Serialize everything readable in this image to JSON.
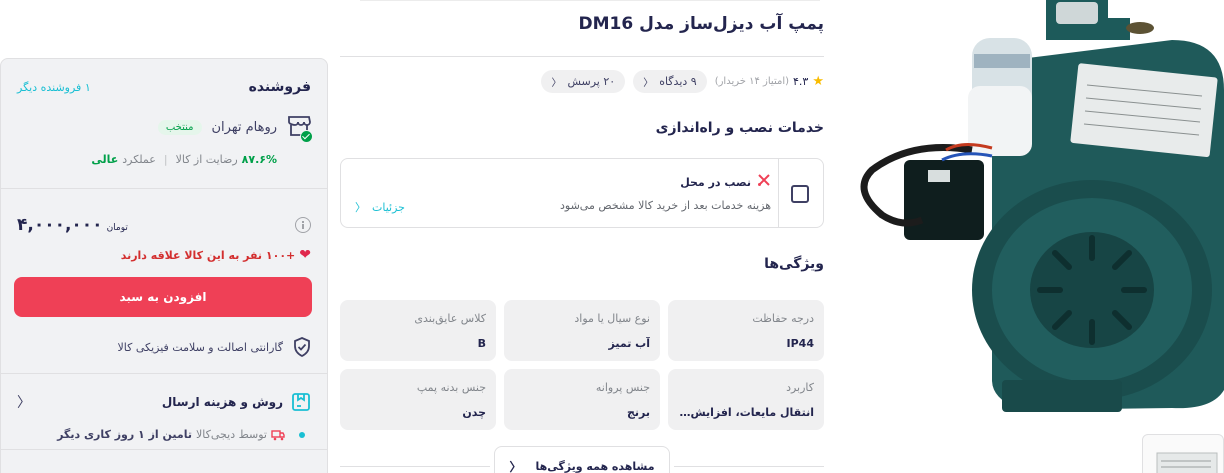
{
  "product": {
    "title": "پمپ آب دیزل‌ساز مدل DM16",
    "rating": "۴.۳",
    "rating_count": "(امتیاز ۱۴ خریدار)",
    "reviews_pill": "۹ دیدگاه",
    "questions_pill": "۲۰ پرسش"
  },
  "services": {
    "title": "خدمات نصب و راه‌اندازی",
    "item_name": "نصب در محل",
    "item_desc": "هزینه خدمات بعد از خرید کالا مشخص می‌شود",
    "details_label": "جزئیات"
  },
  "features": {
    "title": "ویژگی‌ها",
    "items": [
      {
        "label": "درجه حفاظت",
        "value": "IP44"
      },
      {
        "label": "نوع سیال یا مواد",
        "value": "آب تمیز"
      },
      {
        "label": "کلاس عایق‌بندی",
        "value": "B"
      },
      {
        "label": "کاربرد",
        "value": "انتقال مایعات، افزایش ف..."
      },
      {
        "label": "جنس پروانه",
        "value": "برنج"
      },
      {
        "label": "جنس بدنه پمپ",
        "value": "چدن"
      }
    ],
    "all_label": "مشاهده همه ویژگی‌ها"
  },
  "seller": {
    "title": "فروشنده",
    "other_sellers": "۱ فروشنده دیگر",
    "name": "روهام تهران",
    "badge": "منتخب",
    "satisfaction_pct": "۸۷.۶%",
    "satisfaction_label": "رضایت از کالا",
    "performance_label": "عملکرد",
    "performance_value": "عالی",
    "price": "۴,۰۰۰,۰۰۰",
    "currency": "تومان",
    "likes": "+۱۰۰ نفر به این کالا علاقه دارند",
    "add_to_cart": "افزودن به سبد",
    "guarantee": "گارانتی اصالت و سلامت فیزیکی کالا",
    "shipping_title": "روش و هزینه ارسال",
    "shipping_by": "توسط دیجی‌کالا",
    "shipping_supply": "تامین از ۱ روز کاری دیگر"
  },
  "colors": {
    "accent": "#ef4056",
    "link": "#19bfd3",
    "success": "#00a049",
    "pump_body": "#1f5a5a"
  }
}
